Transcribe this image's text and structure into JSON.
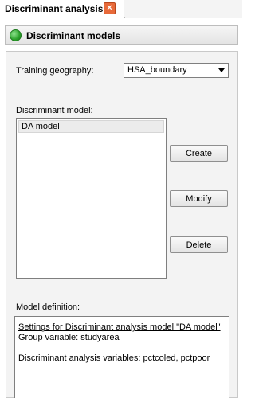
{
  "tab": {
    "label": "Discriminant analysis",
    "close_glyph": "×"
  },
  "panel": {
    "title": "Discriminant models"
  },
  "training": {
    "label": "Training  geography:",
    "selected": "HSA_boundary"
  },
  "model_list": {
    "label": "Discriminant model:",
    "items": [
      "DA model"
    ]
  },
  "buttons": {
    "create": "Create",
    "modify": "Modify",
    "delete": "Delete"
  },
  "definition": {
    "label": "Model definition:",
    "lines": [
      "Settings for Discriminant analysis model \"DA model\"",
      "Group variable: studyarea",
      "",
      "Discriminant analysis variables: pctcoled, pctpoor"
    ]
  },
  "colors": {
    "status": "#2aa12a",
    "close": "#e86a3a"
  }
}
